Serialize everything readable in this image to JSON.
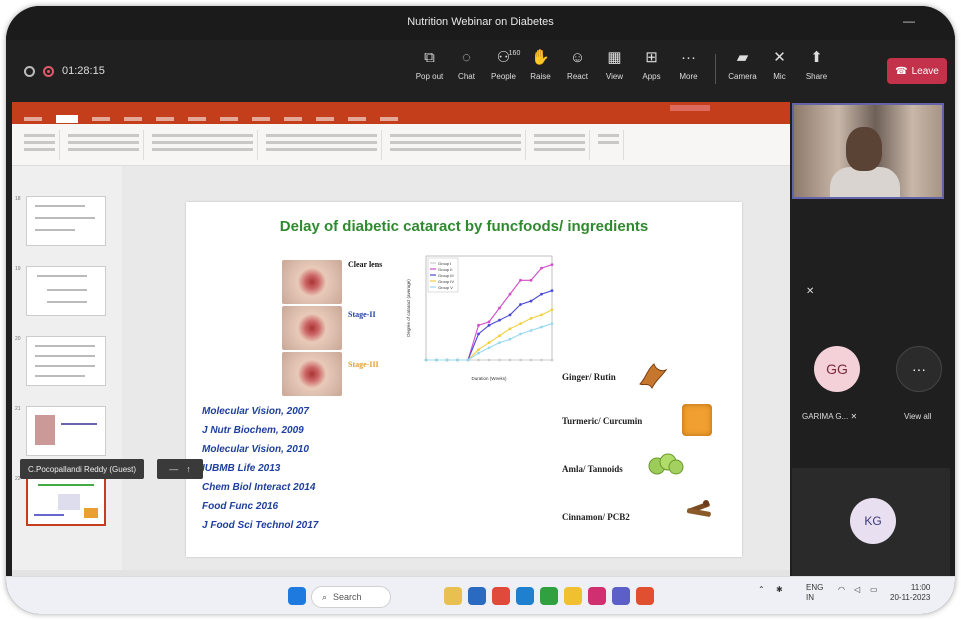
{
  "window": {
    "title": "Nutrition Webinar on Diabetes"
  },
  "call": {
    "timer": "01:28:15",
    "tools": [
      {
        "label": "Pop out",
        "icon": "popout-icon",
        "glyph": "⧉"
      },
      {
        "label": "Chat",
        "icon": "chat-icon",
        "glyph": "◌"
      },
      {
        "label": "People",
        "icon": "people-icon",
        "glyph": "⚇",
        "count": "160"
      },
      {
        "label": "Raise",
        "icon": "raise-hand-icon",
        "glyph": "✋"
      },
      {
        "label": "React",
        "icon": "react-icon",
        "glyph": "☺"
      },
      {
        "label": "View",
        "icon": "view-icon",
        "glyph": "▦"
      },
      {
        "label": "Apps",
        "icon": "apps-icon",
        "glyph": "⊞"
      },
      {
        "label": "More",
        "icon": "more-icon",
        "glyph": "···"
      },
      {
        "label": "Camera",
        "icon": "camera-icon",
        "glyph": "▰"
      },
      {
        "label": "Mic",
        "icon": "mic-icon",
        "glyph": "✕"
      },
      {
        "label": "Share",
        "icon": "share-icon",
        "glyph": "⬆"
      }
    ],
    "leave_label": "Leave"
  },
  "slide": {
    "title": "Delay of diabetic cataract by funcfoods/ ingredients",
    "eye_labels": [
      "Clear lens",
      "Stage-II",
      "Stage-III"
    ],
    "references": [
      "Molecular Vision, 2007",
      "J Nutr Biochem, 2009",
      "Molecular Vision, 2010",
      "IUBMB Life 2013",
      "Chem Biol Interact 2014",
      "Food Func 2016",
      "J Food Sci Technol 2017"
    ],
    "ingredients": [
      "Ginger/ Rutin",
      "Turmeric/ Curcumin",
      "Amla/ Tannoids",
      "Cinnamon/ PCB2"
    ]
  },
  "chart_data": {
    "type": "line",
    "xlabel": "Duration (Weeks)",
    "ylabel": "Degree of cataract (average)",
    "x": [
      0,
      1,
      2,
      3,
      4,
      5,
      6,
      7,
      8,
      9,
      10,
      11,
      12
    ],
    "ylim": [
      0,
      6
    ],
    "series": [
      {
        "name": "Group I",
        "color": "#cccccc",
        "values": [
          0,
          0,
          0,
          0,
          0,
          0,
          0,
          0,
          0,
          0,
          0,
          0,
          0
        ]
      },
      {
        "name": "Group II",
        "color": "#d04ec8",
        "values": [
          0,
          0,
          0,
          0,
          0,
          2,
          2.2,
          3,
          3.8,
          4.6,
          4.6,
          5.3,
          5.5
        ]
      },
      {
        "name": "Group III",
        "color": "#4a4ad6",
        "values": [
          0,
          0,
          0,
          0,
          0,
          1.5,
          2,
          2.3,
          2.6,
          3.2,
          3.4,
          3.8,
          4
        ]
      },
      {
        "name": "Group IV",
        "color": "#f0d040",
        "values": [
          0,
          0,
          0,
          0,
          0,
          0.6,
          1,
          1.4,
          1.8,
          2.1,
          2.4,
          2.6,
          2.9
        ]
      },
      {
        "name": "Group V",
        "color": "#9ad8f0",
        "values": [
          0,
          0,
          0,
          0,
          0,
          0.4,
          0.7,
          1,
          1.2,
          1.5,
          1.7,
          1.9,
          2.1
        ]
      }
    ]
  },
  "presenter": {
    "name": "C.Pocopallandi Reddy (Guest)"
  },
  "participants": [
    {
      "initials": "GG",
      "name": "GARIMA G...",
      "bg": "#f4d0d8",
      "fg": "#7a2c3c"
    },
    {
      "initials": "···",
      "name": "View all",
      "bg": "#2b2b2b",
      "fg": "#ffffff"
    }
  ],
  "kg": {
    "initials": "KG"
  },
  "taskbar": {
    "search_placeholder": "Search",
    "lang": "ENG",
    "region": "IN",
    "time": "11:00",
    "date": "20-11-2023"
  },
  "colors": {
    "accent": "#6264a7",
    "leave": "#c4314b",
    "ppt": "#c43e1c",
    "title_green": "#2f8a2f",
    "refs_blue": "#1f3f9f"
  }
}
